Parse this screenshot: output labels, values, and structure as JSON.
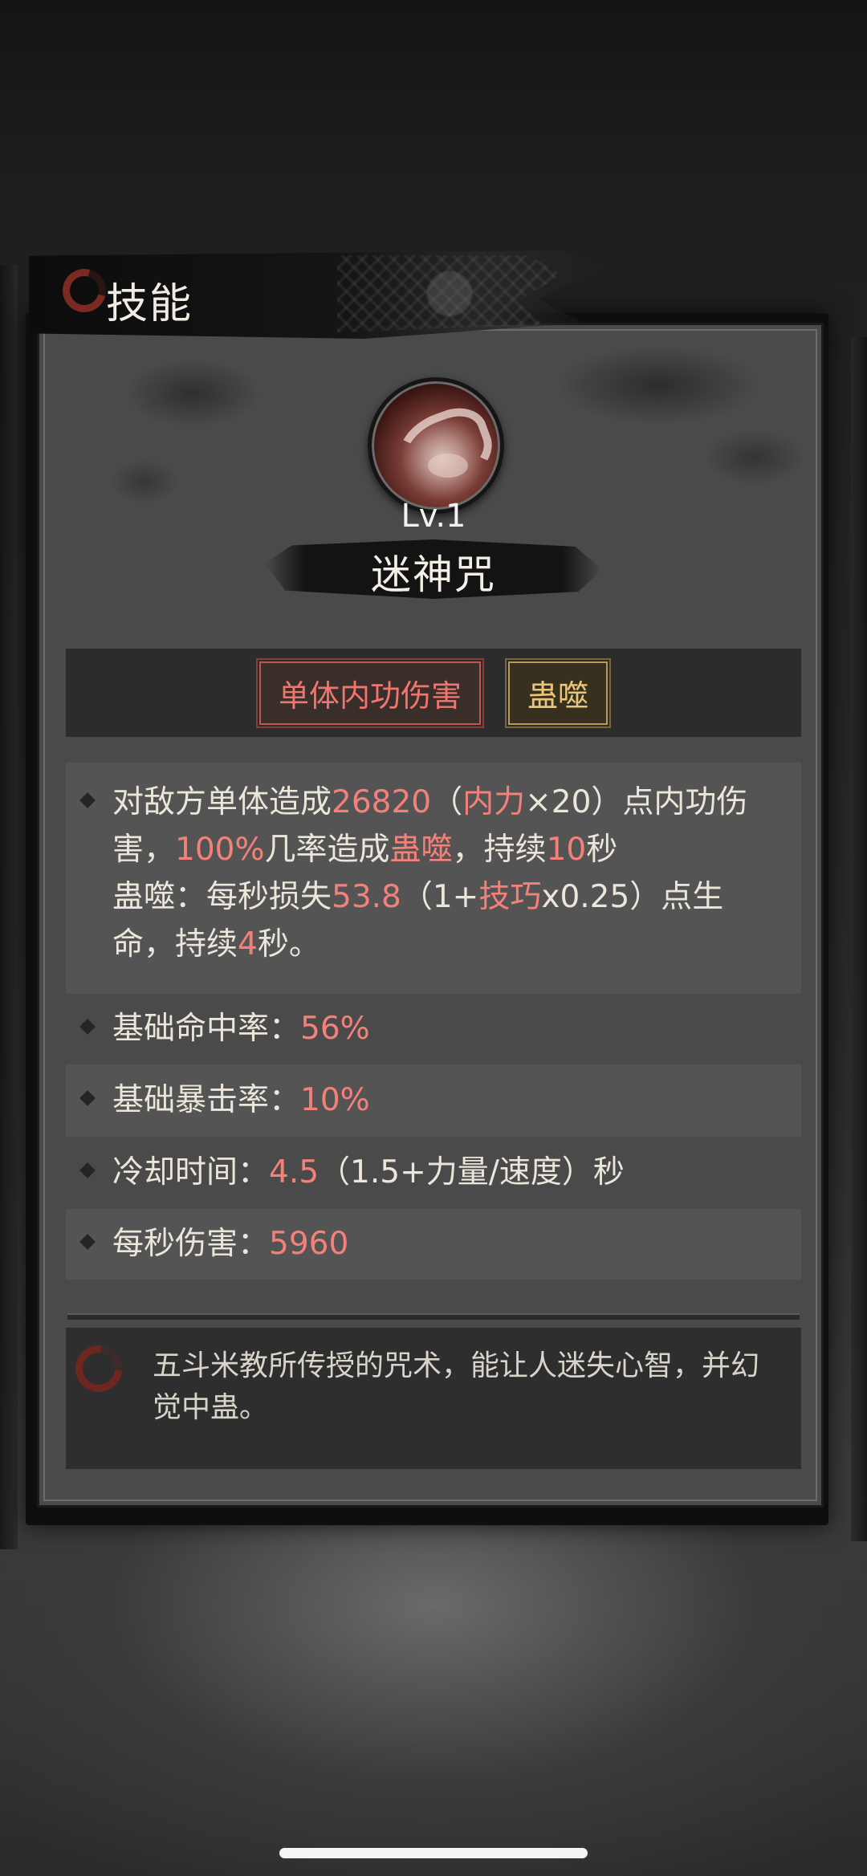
{
  "header": {
    "title": "技能"
  },
  "skill": {
    "level": "Lv.1",
    "name": "迷神咒",
    "tags": [
      "单体内功伤害",
      "蛊噬"
    ]
  },
  "description": {
    "parts": [
      {
        "t": "对敌方单体造成",
        "hl": false
      },
      {
        "t": "26820",
        "hl": true
      },
      {
        "t": "（",
        "hl": false
      },
      {
        "t": "内力",
        "hl": true
      },
      {
        "t": "×20）点内功伤害，",
        "hl": false
      },
      {
        "t": "100%",
        "hl": true
      },
      {
        "t": "几率造成",
        "hl": false
      },
      {
        "t": "蛊噬",
        "hl": true
      },
      {
        "t": "，持续",
        "hl": false
      },
      {
        "t": "10",
        "hl": true
      },
      {
        "t": "秒",
        "hl": false
      },
      {
        "t": "\n",
        "hl": false
      },
      {
        "t": "蛊噬：每秒损失",
        "hl": false
      },
      {
        "t": "53.8",
        "hl": true
      },
      {
        "t": "（1+",
        "hl": false
      },
      {
        "t": "技巧",
        "hl": true
      },
      {
        "t": "x0.25）点生命，持续",
        "hl": false
      },
      {
        "t": "4",
        "hl": true
      },
      {
        "t": "秒。",
        "hl": false
      }
    ]
  },
  "stats": {
    "hit_label": "基础命中率：",
    "hit_value": "56%",
    "crit_label": "基础暴击率：",
    "crit_value": "10%",
    "cooldown_label": "冷却时间：",
    "cooldown_value": "4.5",
    "cooldown_formula": "（1.5+力量/速度）秒",
    "dps_label": "每秒伤害：",
    "dps_value": "5960"
  },
  "flavor": {
    "text": "五斗米教所传授的咒术，能让人迷失心智，并幻觉中蛊。"
  },
  "colors": {
    "highlight": "#f3817a",
    "tag_red": "#f0756f",
    "tag_gold": "#e9c57b",
    "accent_icon": "#7a2a22"
  },
  "icons": {
    "title": "swirl-icon",
    "skill": "skill-avatar",
    "flavor": "swirl-icon",
    "bullet": "diamond-bullet-icon"
  }
}
